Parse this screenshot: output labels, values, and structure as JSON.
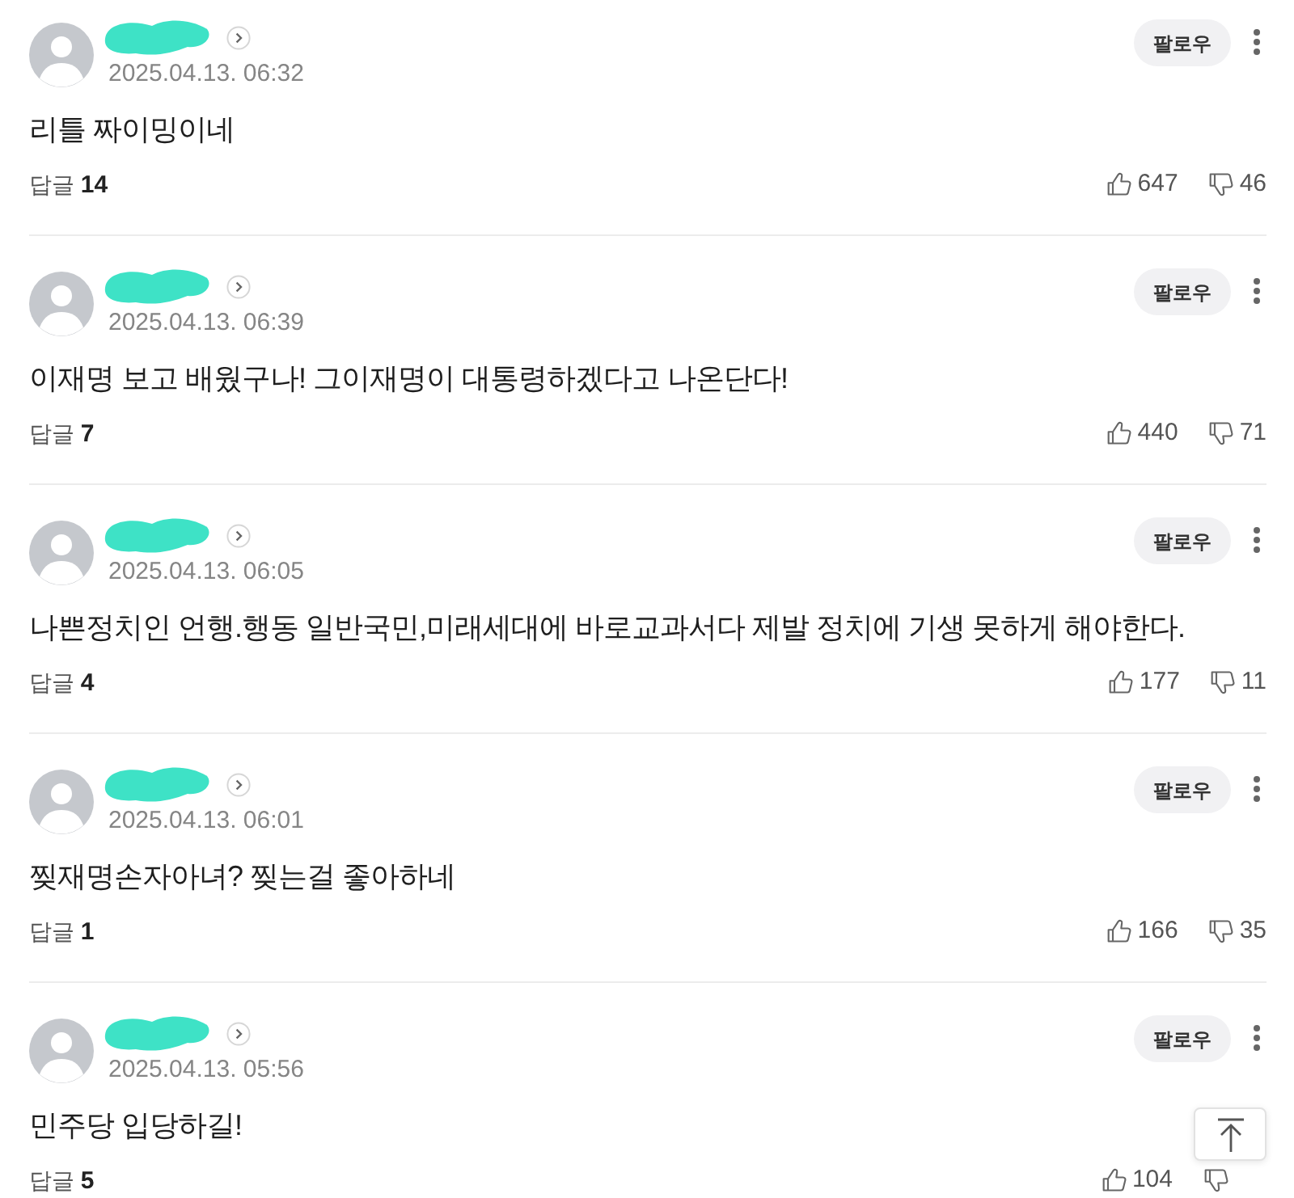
{
  "comments": [
    {
      "date": "2025.04.13. 06:32",
      "text": "리틀 짜이밍이네",
      "follow_label": "팔로우",
      "replies": "답글 **14**",
      "likes": "647",
      "dislikes": "46"
    },
    {
      "date": "2025.04.13. 06:39",
      "text": "이재명 보고 배웠구나! 그이재명이 대통령하겠다고 나온단다!",
      "follow_label": "팔로우",
      "replies": "답글 **7**",
      "likes": "440",
      "dislikes": "71"
    },
    {
      "date": "2025.04.13. 06:05",
      "text": "나쁜정치인 언행.행동 일반국민,미래세대에 바로교과서다 제발 정치에 기생 못하게 해야한다.",
      "follow_label": "팔로우",
      "replies": "답글 **4**",
      "likes": "177",
      "dislikes": "11"
    },
    {
      "date": "2025.04.13. 06:01",
      "text": "찢재명손자아녀? 찢는걸 좋아하네",
      "follow_label": "팔로우",
      "replies": "답글 **1**",
      "likes": "166",
      "dislikes": "35"
    },
    {
      "date": "2025.04.13. 05:56",
      "text": "민주당 입당하길!",
      "follow_label": "팔로우",
      "replies": "답글 **5**",
      "likes": "104"
    }
  ]
}
